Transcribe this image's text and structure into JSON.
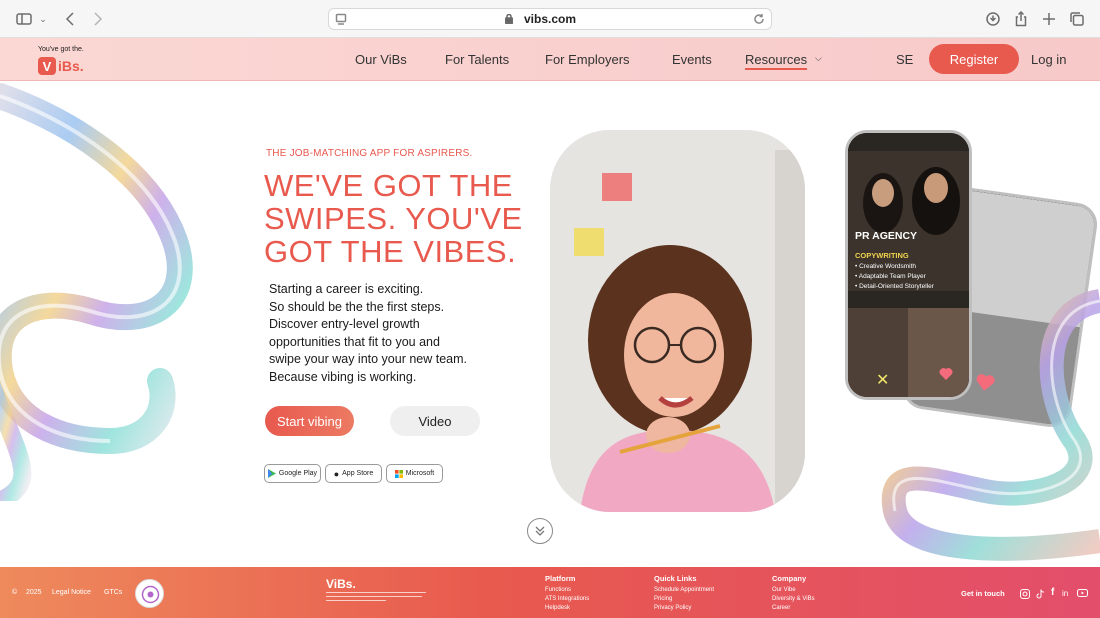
{
  "browser": {
    "url": "vibs.com"
  },
  "header": {
    "tagline": "You've got the.",
    "logo_mark": "V",
    "logo_text": "iBs.",
    "nav": [
      "Our ViBs",
      "For Talents",
      "For Employers",
      "Events",
      "Resources"
    ],
    "lang": "SE",
    "register": "Register",
    "login": "Log in"
  },
  "hero": {
    "eyebrow": "THE JOB-MATCHING APP FOR ASPIRERS.",
    "headline": [
      "WE'VE GOT THE",
      "SWIPES. YOU'VE",
      "GOT THE VIBES."
    ],
    "body": [
      "Starting a career is exciting.",
      "So should be the the first steps.",
      "Discover entry-level growth",
      "opportunities that fit to you and",
      "swipe your way into your new team.",
      "Because vibing is working."
    ],
    "cta_primary": "Start vibing",
    "cta_secondary": "Video",
    "stores": [
      "Google Play",
      "App Store",
      "Microsoft"
    ]
  },
  "phone": {
    "company": "PR AGENCY",
    "role": "COPYWRITING",
    "traits": [
      "Creative Wordsmith",
      "Adaptable Team Player",
      "Detail-Oriented Storyteller"
    ]
  },
  "footer": {
    "year": "2025",
    "legal": "Legal Notice",
    "gtcs": "GTCs",
    "logo": "ViBs.",
    "get_in_touch": "Get in touch",
    "columns": [
      {
        "title": "Platform",
        "links": [
          "Functions",
          "ATS Integrations",
          "Helpdesk"
        ]
      },
      {
        "title": "Quick Links",
        "links": [
          "Schedule Appointment",
          "Pricing",
          "Privacy Policy"
        ]
      },
      {
        "title": "Company",
        "links": [
          "Our Vibe",
          "Diversity & ViBs",
          "Career"
        ]
      }
    ]
  },
  "colors": {
    "accent": "#e8594e",
    "header_bg": "#fbd8d4"
  }
}
